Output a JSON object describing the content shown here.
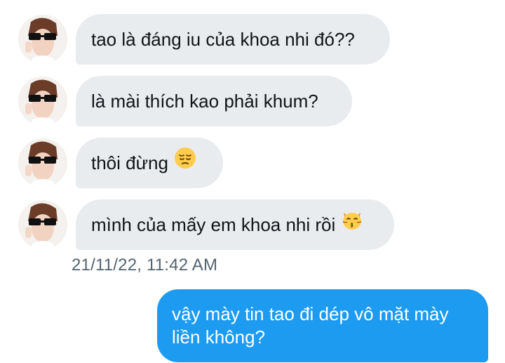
{
  "messages_received": [
    {
      "text": "tao là đáng iu của khoa nhi đó??"
    },
    {
      "text": "là mài thích kao phải khum?"
    },
    {
      "text": "thôi đừng",
      "emoji": "pensive-face-emoji"
    },
    {
      "text": "mình của mấy em khoa nhi rồi",
      "emoji": "kissing-cat-emoji"
    }
  ],
  "timestamp": "21/11/22, 11:42 AM",
  "message_sent": {
    "line1": "vậy mày tin tao đi dép vô mặt mày",
    "line2": "liền không?"
  },
  "colors": {
    "received_bubble": "#e9ecef",
    "sent_bubble": "#1d9bf0",
    "timestamp_text": "#536471"
  }
}
